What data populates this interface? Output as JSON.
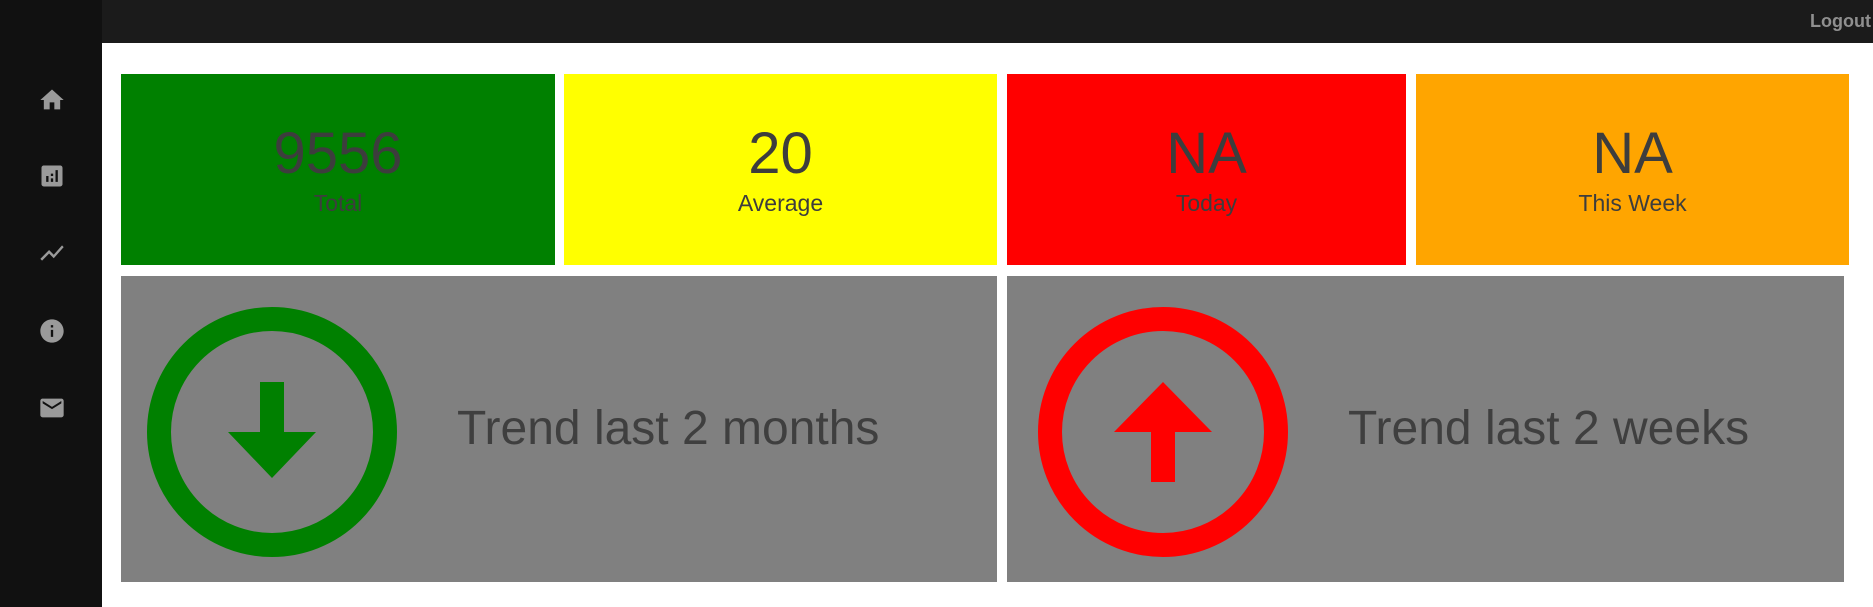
{
  "topbar": {
    "logout_label": "Logout"
  },
  "sidebar": {
    "items": [
      {
        "icon": "home-icon"
      },
      {
        "icon": "bar-chart-icon"
      },
      {
        "icon": "line-chart-icon"
      },
      {
        "icon": "info-icon"
      },
      {
        "icon": "mail-icon"
      }
    ]
  },
  "stats": [
    {
      "value": "9556",
      "label": "Total",
      "color": "#008000"
    },
    {
      "value": "20",
      "label": "Average",
      "color": "#ffff00"
    },
    {
      "value": "NA",
      "label": "Today",
      "color": "#ff0000"
    },
    {
      "value": "NA",
      "label": "This Week",
      "color": "#ffa500"
    }
  ],
  "trends": [
    {
      "label": "Trend last 2 months",
      "direction": "down",
      "color": "#008000",
      "icon": "arrow-down-circle-icon"
    },
    {
      "label": "Trend last 2 weeks",
      "direction": "up",
      "color": "#ff0000",
      "icon": "arrow-up-circle-icon"
    }
  ],
  "colors": {
    "sidebar": "#111111",
    "topbar": "#1b1b1b",
    "panel": "#808080"
  }
}
